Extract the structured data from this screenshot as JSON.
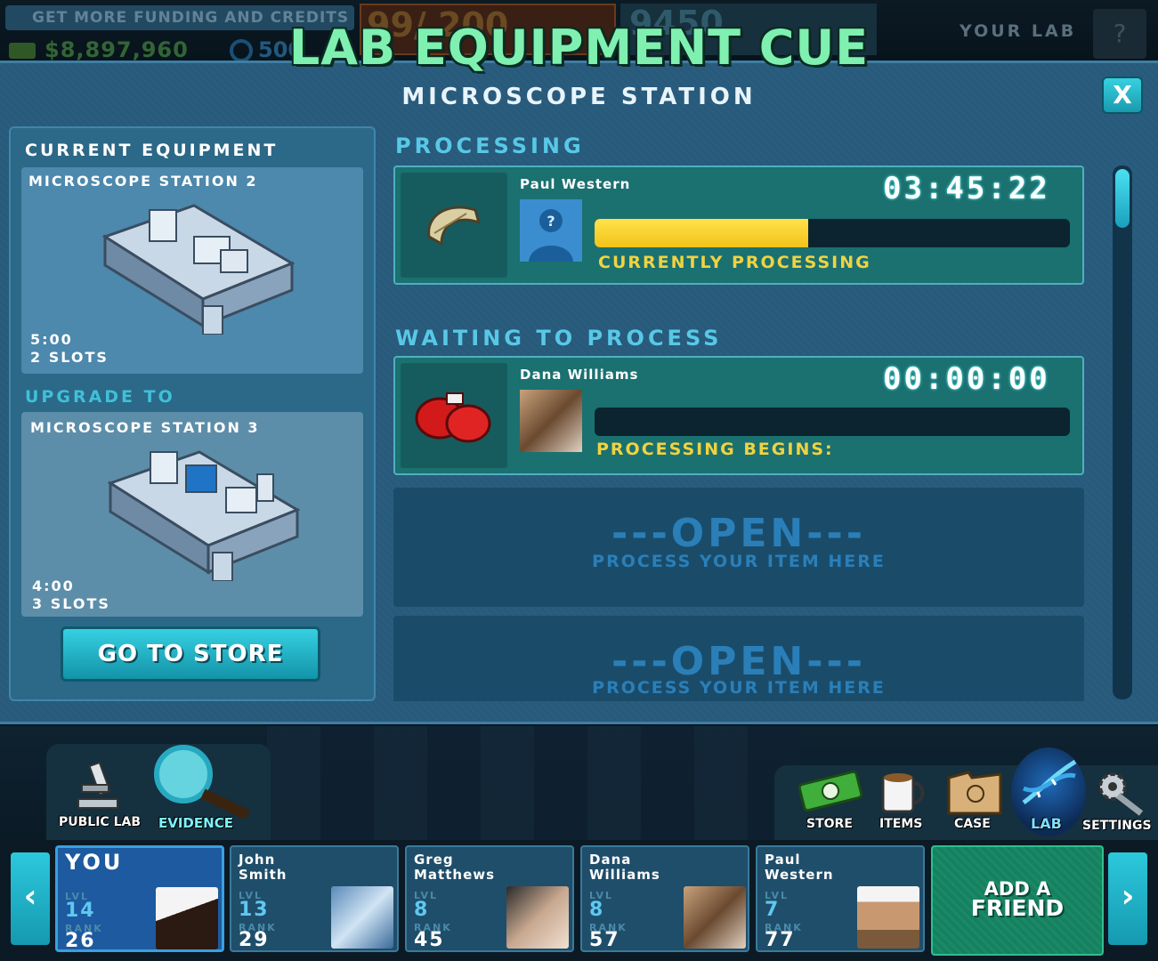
{
  "top_bar": {
    "funding_banner": "GET MORE FUNDING AND CREDITS",
    "money": "$8,897,960",
    "credits": "500",
    "xp": "99/ 200",
    "score": "9450",
    "your_lab": "YOUR LAB",
    "avatar_glyph": "?"
  },
  "game_title": "LAB EQUIPMENT CUE",
  "dialog": {
    "subtitle": "MICROSCOPE STATION",
    "close_label": "X",
    "left": {
      "current_heading": "CURRENT EQUIPMENT",
      "current_name": "MICROSCOPE STATION 2",
      "current_time": "5:00",
      "current_slots": "2 SLOTS",
      "upgrade_heading": "UPGRADE TO",
      "upgrade_name": "MICROSCOPE STATION 3",
      "upgrade_time": "4:00",
      "upgrade_slots": "3 SLOTS",
      "store_button": "GO TO STORE"
    },
    "processing_heading": "PROCESSING",
    "processing": {
      "name": "Paul Western",
      "timer": "03:45:22",
      "progress": 0.45,
      "status": "CURRENTLY PROCESSING",
      "item_icon": "bracelet-icon"
    },
    "waiting_heading": "WAITING TO PROCESS",
    "waiting": {
      "name": "Dana Williams",
      "timer": "00:00:00",
      "progress": 0,
      "status": "PROCESSING BEGINS:",
      "item_icon": "boxing-gloves-icon"
    },
    "open_slots": [
      {
        "title": "---OPEN---",
        "subtitle": "PROCESS YOUR ITEM HERE"
      },
      {
        "title": "---OPEN---",
        "subtitle": "PROCESS YOUR ITEM HERE"
      }
    ]
  },
  "tools_left": [
    {
      "label": "PUBLIC LAB",
      "icon": "microscope-icon"
    },
    {
      "label": "EVIDENCE",
      "icon": "magnifier-icon"
    }
  ],
  "tools_right": [
    {
      "label": "STORE",
      "icon": "cash-icon"
    },
    {
      "label": "ITEMS",
      "icon": "mug-icon"
    },
    {
      "label": "CASE",
      "icon": "folder-icon"
    },
    {
      "label": "LAB",
      "icon": "dna-icon"
    },
    {
      "label": "SETTINGS",
      "icon": "gear-wrench-icon"
    }
  ],
  "friends": {
    "lvl_label": "LVL",
    "rank_label": "RANK",
    "list": [
      {
        "name_line1": "YOU",
        "name_line2": "",
        "lvl": "14",
        "rank": "26"
      },
      {
        "name_line1": "John",
        "name_line2": "Smith",
        "lvl": "13",
        "rank": "29"
      },
      {
        "name_line1": "Greg",
        "name_line2": "Matthews",
        "lvl": "8",
        "rank": "45"
      },
      {
        "name_line1": "Dana",
        "name_line2": "Williams",
        "lvl": "8",
        "rank": "57"
      },
      {
        "name_line1": "Paul",
        "name_line2": "Western",
        "lvl": "7",
        "rank": "77"
      }
    ],
    "add_friend_line1": "ADD A",
    "add_friend_line2": "FRIEND",
    "prev_glyph": "‹",
    "next_glyph": "›"
  },
  "colors": {
    "accent_cyan": "#36d0e2",
    "title_green": "#7ff0b0",
    "status_yellow": "#f0d340",
    "progress_yellow": "#ffe24a"
  }
}
